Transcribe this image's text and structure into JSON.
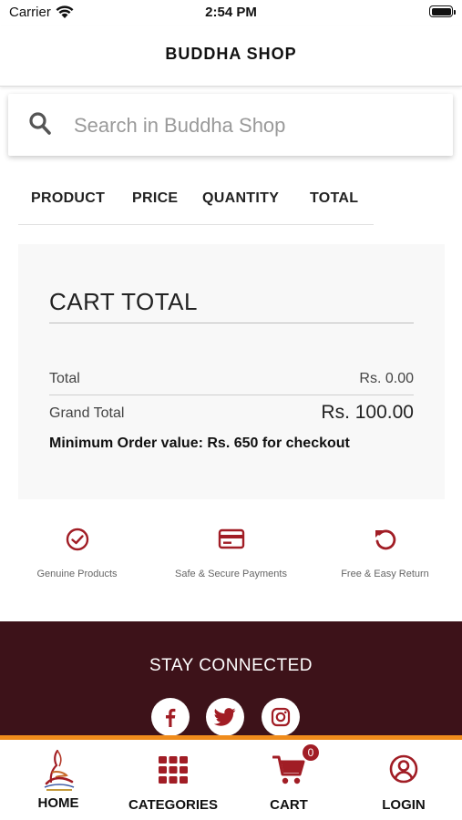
{
  "status_bar": {
    "carrier": "Carrier",
    "time": "2:54 PM"
  },
  "header": {
    "title": "BUDDHA SHOP"
  },
  "search": {
    "placeholder": "Search in Buddha Shop",
    "value": ""
  },
  "cart_columns": [
    "PRODUCT",
    "PRICE",
    "QUANTITY",
    "TOTAL"
  ],
  "cart_total": {
    "heading": "CART TOTAL",
    "total_label": "Total",
    "total_value": "Rs. 0.00",
    "grand_total_label": "Grand Total",
    "grand_total_value": "Rs. 100.00",
    "min_order_note": "Minimum Order value: Rs. 650 for checkout"
  },
  "features": [
    {
      "label": "Genuine Products",
      "icon": "check-circle-icon"
    },
    {
      "label": "Safe & Secure Payments",
      "icon": "credit-card-icon"
    },
    {
      "label": "Free & Easy Return",
      "icon": "return-arrow-icon"
    }
  ],
  "footer": {
    "heading": "STAY CONNECTED",
    "social": [
      "facebook-icon",
      "twitter-icon",
      "instagram-icon"
    ]
  },
  "tabs": [
    {
      "label": "HOME",
      "icon": "buddha-shop-logo"
    },
    {
      "label": "CATEGORIES",
      "icon": "grid-icon"
    },
    {
      "label": "CART",
      "icon": "cart-icon"
    },
    {
      "label": "LOGIN",
      "icon": "user-icon"
    }
  ],
  "cart_badge": "0",
  "colors": {
    "accent": "#a11d25",
    "footer_bg": "#3d1219",
    "stripe": "#f08c1c",
    "card_bg": "#f8f8f8"
  }
}
